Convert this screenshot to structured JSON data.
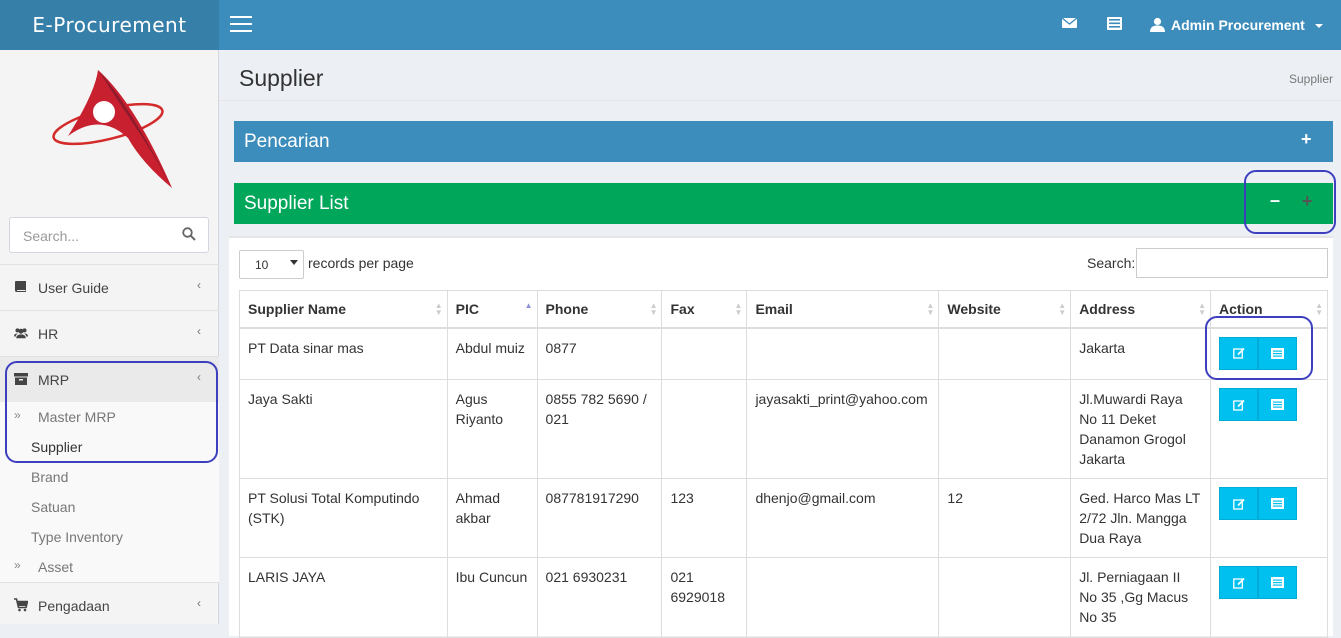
{
  "brand": "E-Procurement",
  "user": "Admin Procurement",
  "sidebar": {
    "search_placeholder": "Search...",
    "items": [
      {
        "label": "User Guide"
      },
      {
        "label": "HR"
      },
      {
        "label": "MRP"
      },
      {
        "label": "Pengadaan"
      }
    ],
    "subitems": [
      {
        "label": "Master MRP"
      },
      {
        "label": "Supplier"
      },
      {
        "label": "Brand"
      },
      {
        "label": "Satuan"
      },
      {
        "label": "Type Inventory"
      },
      {
        "label": "Asset"
      }
    ]
  },
  "page": {
    "title": "Supplier",
    "breadcrumb": "Supplier"
  },
  "panels": {
    "search_title": "Pencarian",
    "list_title": "Supplier List"
  },
  "table_controls": {
    "page_size": "10",
    "records_label": "records per page",
    "search_label": "Search:"
  },
  "table": {
    "headers": [
      "Supplier Name",
      "PIC",
      "Phone",
      "Fax",
      "Email",
      "Website",
      "Address",
      "Action"
    ],
    "rows": [
      [
        "PT Data sinar mas",
        "Abdul muiz",
        "0877",
        "",
        "",
        "",
        "Jakarta"
      ],
      [
        "Jaya Sakti",
        "Agus Riyanto",
        "0855 782 5690 / 021",
        "",
        "jayasakti_print@yahoo.com",
        "",
        "Jl.Muwardi Raya No 11 Deket Danamon Grogol Jakarta"
      ],
      [
        "PT Solusi Total Komputindo (STK)",
        "Ahmad akbar",
        "087781917290",
        "123",
        "dhenjo@gmail.com",
        "12",
        "Ged. Harco Mas LT 2/72 Jln. Mangga Dua Raya"
      ],
      [
        "LARIS JAYA",
        "Ibu Cuncun",
        "021 6930231",
        "021 6929018",
        "",
        "",
        "Jl. Perniagaan II No 35 ,Gg Macus No 35"
      ]
    ]
  },
  "colors": {
    "topbar": "#3c8dbc",
    "brand_bg": "#367fa9",
    "panel_blue": "#3c8dbc",
    "panel_green": "#00a65a",
    "action_button": "#00c0ef",
    "annotation_ring": "#3d3fbf"
  }
}
